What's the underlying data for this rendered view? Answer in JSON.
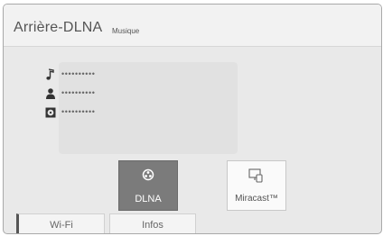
{
  "header": {
    "title": "Arrière-DLNA",
    "subtitle": "Musique"
  },
  "info": {
    "rows": [
      {
        "icon": "music-note-icon",
        "value": "••••••••••"
      },
      {
        "icon": "person-icon",
        "value": "••••••••••"
      },
      {
        "icon": "album-icon",
        "value": "••••••••••"
      }
    ]
  },
  "sources": {
    "dlna_label": "DLNA",
    "miracast_label": "Miracast™",
    "selected": "DLNA"
  },
  "tabs": {
    "wifi": "Wi-Fi",
    "infos": "Infos"
  }
}
